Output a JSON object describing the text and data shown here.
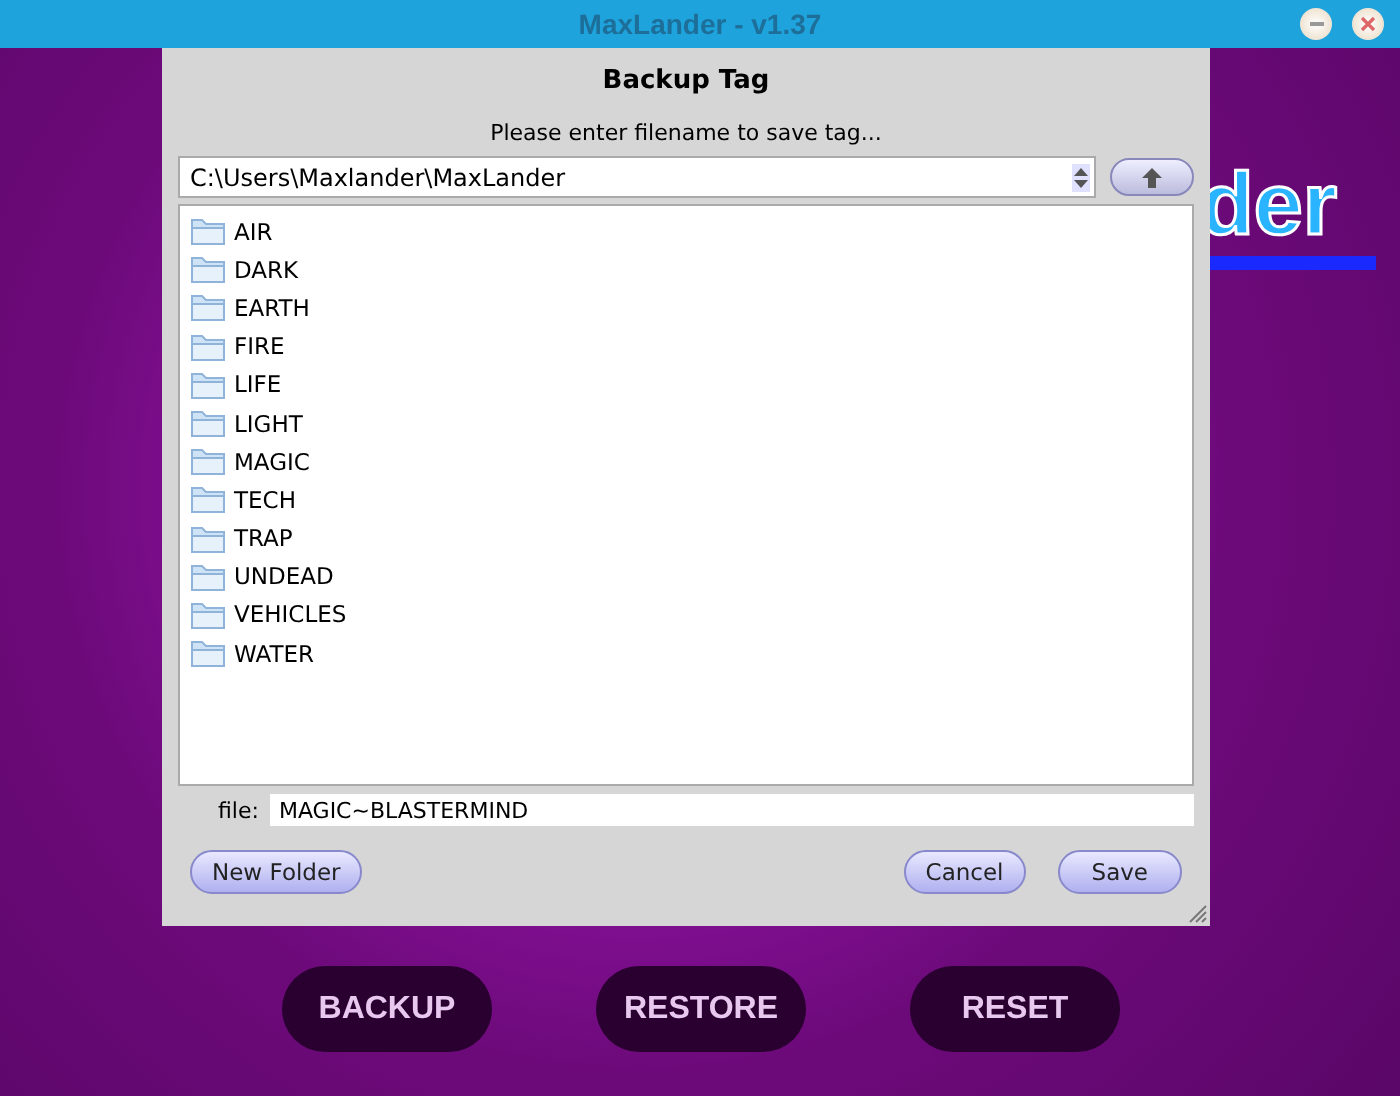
{
  "window": {
    "title": "MaxLander - v1.37"
  },
  "logo": {
    "text": "der"
  },
  "dialog": {
    "title": "Backup Tag",
    "prompt": "Please enter filename to save tag...",
    "path": "C:\\Users\\Maxlander\\MaxLander",
    "folders": [
      {
        "name": "AIR"
      },
      {
        "name": "DARK"
      },
      {
        "name": "EARTH"
      },
      {
        "name": "FIRE"
      },
      {
        "name": "LIFE"
      },
      {
        "name": "LIGHT"
      },
      {
        "name": "MAGIC"
      },
      {
        "name": "TECH"
      },
      {
        "name": "TRAP"
      },
      {
        "name": "UNDEAD"
      },
      {
        "name": "VEHICLES"
      },
      {
        "name": "WATER"
      }
    ],
    "file_label": "file:",
    "file_value": "MAGIC~BLASTERMIND",
    "new_folder": "New Folder",
    "cancel": "Cancel",
    "save": "Save"
  },
  "actions": [
    "BACKUP",
    "RESTORE",
    "RESET"
  ]
}
